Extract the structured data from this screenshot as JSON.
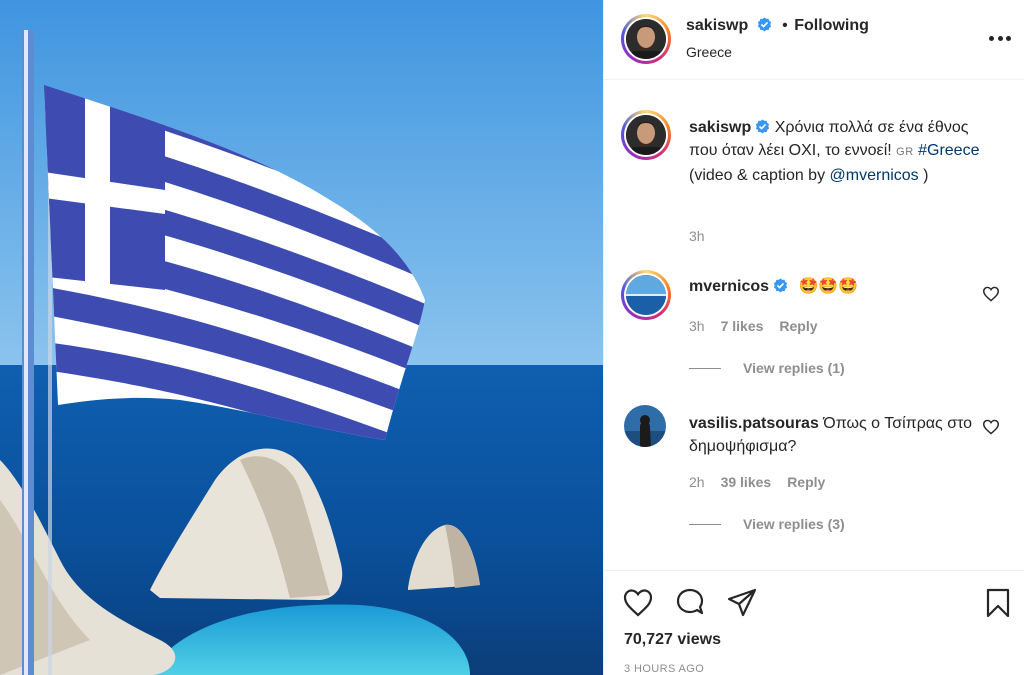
{
  "post": {
    "media_alt": "",
    "username": "sakiswp",
    "follow_dot": "•",
    "follow_status": "Following",
    "location": "Greece",
    "caption_text": "Χρόνια πολλά σε ένα έθνος που όταν λέει ΟΧΙ, το εννοεί!",
    "caption_flag": "GR",
    "caption_hashtag": "#Greece",
    "caption_suffix": "(video & caption by",
    "caption_mention": "@mvernicos",
    "caption_close": ")",
    "caption_time": "3h"
  },
  "comments": [
    {
      "username": "mvernicos",
      "verified": true,
      "text": "🤩🤩🤩",
      "time": "3h",
      "likes": "7 likes",
      "reply_label": "Reply",
      "view_replies": "View replies (1)"
    },
    {
      "username": "vasilis.patsouras",
      "verified": false,
      "text": "Όπως ο Τσίπρας στο δημοψήφισμα?",
      "time": "2h",
      "likes": "39 likes",
      "reply_label": "Reply",
      "view_replies": "View replies (3)"
    }
  ],
  "footer": {
    "views": "70,727 views",
    "posted": "3 HOURS AGO"
  },
  "colors": {
    "accent_link": "#00376b",
    "verified_blue": "#3897f0",
    "flag_blue": "#3e4cb1"
  },
  "icons": [
    "more-options-icon",
    "verified-icon",
    "heart-icon",
    "comment-icon",
    "share-icon",
    "bookmark-icon"
  ]
}
